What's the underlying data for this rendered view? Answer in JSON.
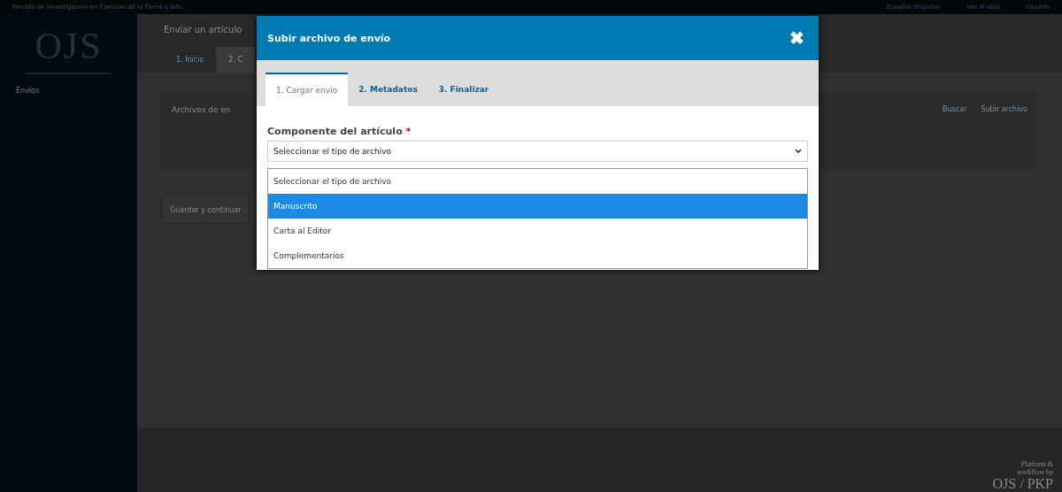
{
  "top_bar": {
    "site_title": "Revista de Investigación en Ciencias de la Tierra y Am...",
    "links": [
      "Español (España)",
      "Ver el sitio",
      "Usuario"
    ]
  },
  "sidebar": {
    "logo": "OJS",
    "items": [
      {
        "label": "Envíos",
        "selected": false
      }
    ]
  },
  "page": {
    "title": "Enviar un artículo",
    "steps": [
      {
        "label": "1. Inicio",
        "selected": false
      },
      {
        "label": "2. C",
        "selected": true
      }
    ],
    "panel_title": "Archivos de en",
    "panel_actions": [
      "Buscar",
      "Subir archivo"
    ],
    "save_button": "Guardar y continuar"
  },
  "footer": {
    "brand_line_1": "Platform &",
    "brand_line_2": "workflow by",
    "brand_logo": "OJS / PKP"
  },
  "modal": {
    "title": "Subir archivo de envío",
    "close": "✖",
    "tabs": [
      {
        "label": "1. Cargar envío",
        "selected": true
      },
      {
        "label": "2. Metadatos",
        "selected": false
      },
      {
        "label": "3. Finalizar",
        "selected": false
      }
    ],
    "field_label": "Componente del artículo",
    "required_mark": "*",
    "select_value": "Seleccionar el tipo de archivo",
    "options": [
      {
        "label": "Seleccionar el tipo de archivo",
        "selected": false
      },
      {
        "label": "Manuscrito",
        "selected": true
      },
      {
        "label": "Carta al Editor",
        "selected": false
      },
      {
        "label": "Complementarios",
        "selected": false
      }
    ]
  }
}
